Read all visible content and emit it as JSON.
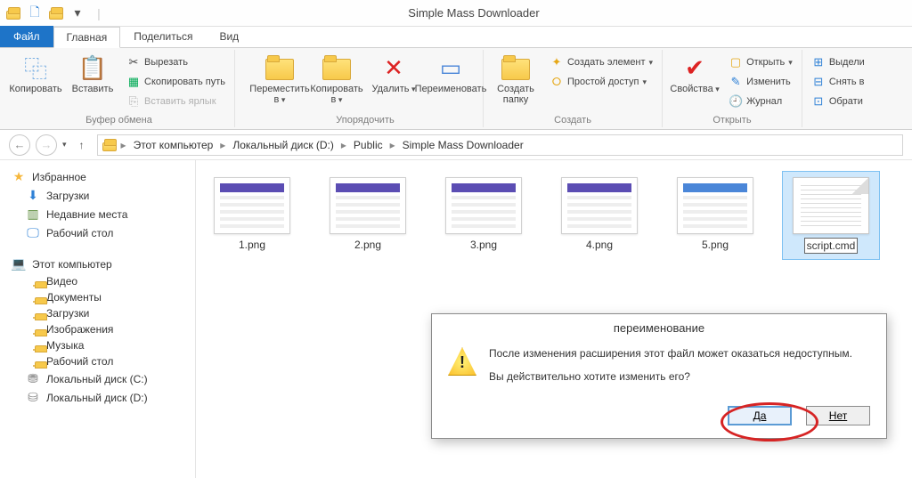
{
  "window": {
    "title": "Simple Mass Downloader"
  },
  "tabs": {
    "file": "Файл",
    "home": "Главная",
    "share": "Поделиться",
    "view": "Вид"
  },
  "ribbon": {
    "clipboard": {
      "label": "Буфер обмена",
      "copy": "Копировать",
      "paste": "Вставить",
      "cut": "Вырезать",
      "copypath": "Скопировать путь",
      "pasteshortcut": "Вставить ярлык"
    },
    "organize": {
      "label": "Упорядочить",
      "moveto": "Переместить в",
      "copyto": "Копировать в",
      "delete": "Удалить",
      "rename": "Переименовать"
    },
    "new": {
      "label": "Создать",
      "newfolder": "Создать папку",
      "newitem": "Создать элемент",
      "easyaccess": "Простой доступ"
    },
    "open": {
      "label": "Открыть",
      "properties": "Свойства",
      "open": "Открыть",
      "edit": "Изменить",
      "history": "Журнал"
    },
    "select": {
      "selectall": "Выдели",
      "selectnone": "Снять в",
      "invert": "Обрати"
    }
  },
  "breadcrumb": {
    "items": [
      "Этот компьютер",
      "Локальный диск (D:)",
      "Public",
      "Simple Mass Downloader"
    ]
  },
  "nav": {
    "favorites": {
      "label": "Избранное",
      "items": [
        "Загрузки",
        "Недавние места",
        "Рабочий стол"
      ]
    },
    "computer": {
      "label": "Этот компьютер",
      "items": [
        "Видео",
        "Документы",
        "Загрузки",
        "Изображения",
        "Музыка",
        "Рабочий стол",
        "Локальный диск (C:)",
        "Локальный диск (D:)"
      ]
    }
  },
  "files": [
    {
      "name": "1.png",
      "type": "screenshot"
    },
    {
      "name": "2.png",
      "type": "screenshot"
    },
    {
      "name": "3.png",
      "type": "screenshot"
    },
    {
      "name": "4.png",
      "type": "screenshot"
    },
    {
      "name": "5.png",
      "type": "screenshot2"
    },
    {
      "name": "script.cmd",
      "type": "txt",
      "selected": true
    }
  ],
  "dialog": {
    "title": "переименование",
    "line1": "После изменения расширения этот файл может оказаться недоступным.",
    "line2": "Вы действительно хотите изменить его?",
    "yes": "Да",
    "no": "Нет"
  }
}
